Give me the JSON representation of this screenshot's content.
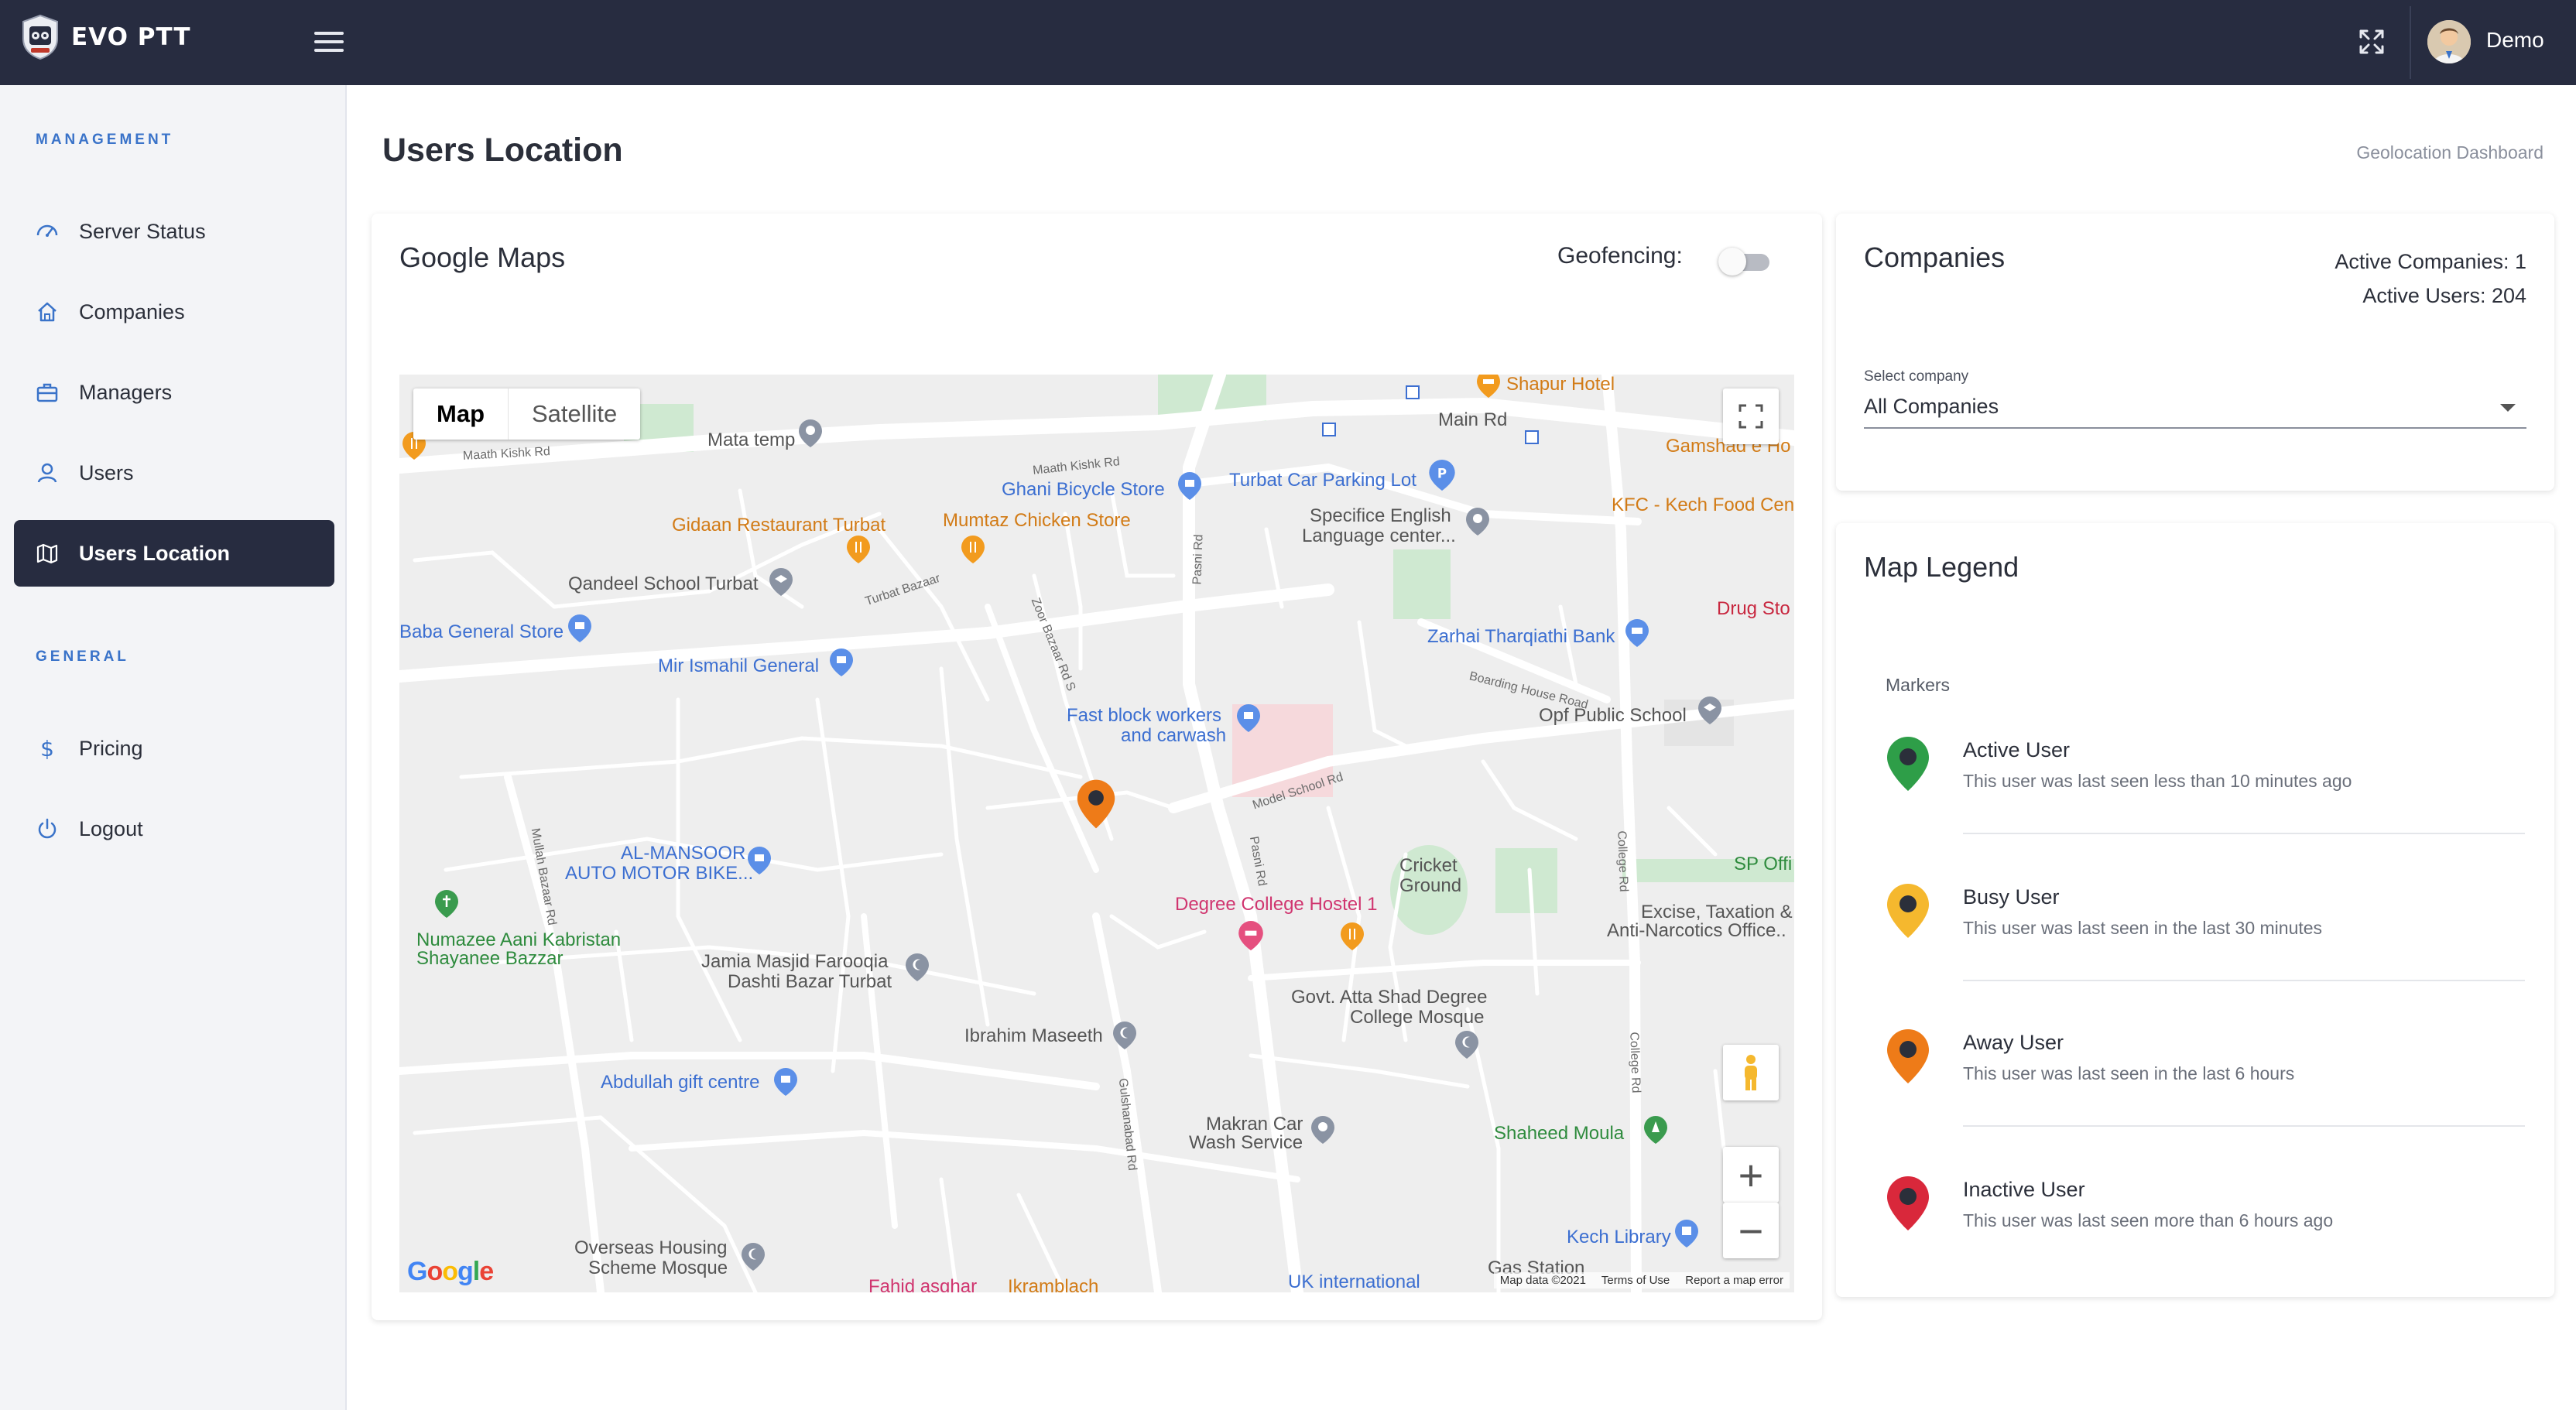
{
  "app": {
    "brand": "EVO PTT",
    "user_name": "Demo"
  },
  "sidebar": {
    "management_title": "MANAGEMENT",
    "general_title": "GENERAL",
    "items": [
      {
        "label": "Server Status",
        "icon": "dashboard-icon"
      },
      {
        "label": "Companies",
        "icon": "home-icon"
      },
      {
        "label": "Managers",
        "icon": "briefcase-icon"
      },
      {
        "label": "Users",
        "icon": "user-icon"
      },
      {
        "label": "Users Location",
        "icon": "map-icon",
        "active": true
      },
      {
        "label": "Pricing",
        "icon": "dollar-icon"
      },
      {
        "label": "Logout",
        "icon": "power-icon"
      }
    ]
  },
  "page": {
    "title": "Users Location",
    "breadcrumb": "Geolocation Dashboard"
  },
  "map_card": {
    "title": "Google Maps",
    "geofencing_label": "Geofencing:",
    "geofencing_enabled": false,
    "map_type": {
      "map": "Map",
      "satellite": "Satellite",
      "selected": "Map"
    },
    "zoom_in": "+",
    "zoom_out": "−",
    "google": "Google",
    "footer": {
      "data": "Map data ©2021",
      "terms": "Terms of Use",
      "report": "Report a map error"
    },
    "places": [
      "Mata temp",
      "Shapur Hotel",
      "Gamshad e Ho",
      "Main Rd",
      "Ghani Bicycle Store",
      "Turbat Car Parking Lot",
      "Gidaan Restaurant Turbat",
      "Mumtaz Chicken Store",
      "Specifice English",
      "Language center...",
      "KFC - Kech Food Cen",
      "Qandeel School Turbat",
      "Baba General Store",
      "Drug Sto",
      "Mir Ismahil General",
      "Zarhai Tharqiathi Bank",
      "Fast block workers",
      "and carwash",
      "Opf Public School",
      "AL-MANSOOR",
      "AUTO MOTOR BIKE...",
      "Cricket",
      "Ground",
      "SP Offi",
      "Degree College Hostel 1",
      "Excise, Taxation &",
      "Anti-Narcotics Office..",
      "Numazee Aani Kabristan",
      "Shayanee Bazzar",
      "Jamia Masjid Farooqia",
      "Dashti Bazar Turbat",
      "Govt. Atta Shad Degree",
      "College Mosque",
      "Ibrahim Maseeth",
      "Abdullah gift centre",
      "Makran Car",
      "Wash Service",
      "Shaheed Moula",
      "Kech Library",
      "Overseas Housing",
      "Scheme Mosque",
      "UK international",
      "Fahid asghar",
      "Ikramblach",
      "Gas Station"
    ],
    "roads": [
      "Maath Kishk Rd",
      "Maath Kishk Rd",
      "Turbat Bazaar",
      "Zoor Bazaar Rd S",
      "Pasni Rd",
      "Boarding House Road",
      "Model School Rd",
      "Pasni Rd",
      "College Rd",
      "College Rd",
      "Mullah Bazaar Rd",
      "Gulshanabad Rd"
    ]
  },
  "companies_card": {
    "title": "Companies",
    "active_companies": "Active Companies: 1",
    "active_users": "Active Users: 204",
    "select_label": "Select company",
    "select_value": "All Companies"
  },
  "legend_card": {
    "title": "Map Legend",
    "markers_label": "Markers",
    "items": [
      {
        "name": "Active User",
        "desc": "This user was last seen less than 10 minutes ago",
        "color": "#2e9e48"
      },
      {
        "name": "Busy User",
        "desc": "This user was last seen in the last 30 minutes",
        "color": "#f5b82e"
      },
      {
        "name": "Away User",
        "desc": "This user was last seen in the last 6 hours",
        "color": "#ee7b18"
      },
      {
        "name": "Inactive User",
        "desc": "This user was last seen more than 6 hours ago",
        "color": "#d9283b"
      }
    ]
  },
  "colors": {
    "topbar": "#272c40",
    "accent": "#3a73c9",
    "active_nav": "#272c40"
  }
}
